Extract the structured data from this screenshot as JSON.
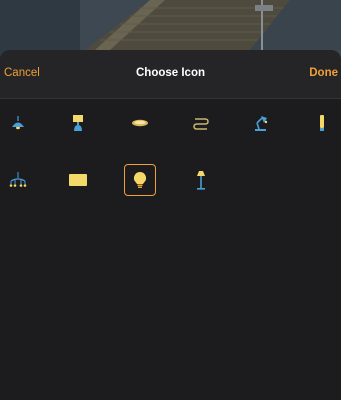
{
  "header": {
    "cancel_label": "Cancel",
    "title": "Choose Icon",
    "done_label": "Done"
  },
  "icons": [
    {
      "name": "pendant-lamp-icon",
      "selected": false
    },
    {
      "name": "table-lamp-icon",
      "selected": false
    },
    {
      "name": "ceiling-light-icon",
      "selected": false
    },
    {
      "name": "light-strip-icon",
      "selected": false
    },
    {
      "name": "desk-lamp-icon",
      "selected": false
    },
    {
      "name": "wall-light-icon",
      "selected": false
    },
    {
      "name": "chandelier-icon",
      "selected": false
    },
    {
      "name": "light-panel-icon",
      "selected": false
    },
    {
      "name": "light-bulb-icon",
      "selected": true
    },
    {
      "name": "floor-lamp-icon",
      "selected": false
    }
  ],
  "colors": {
    "accent": "#f0a035",
    "icon_yellow": "#f5d86a",
    "icon_blue": "#4a9fd8",
    "background": "#1c1c1e"
  }
}
